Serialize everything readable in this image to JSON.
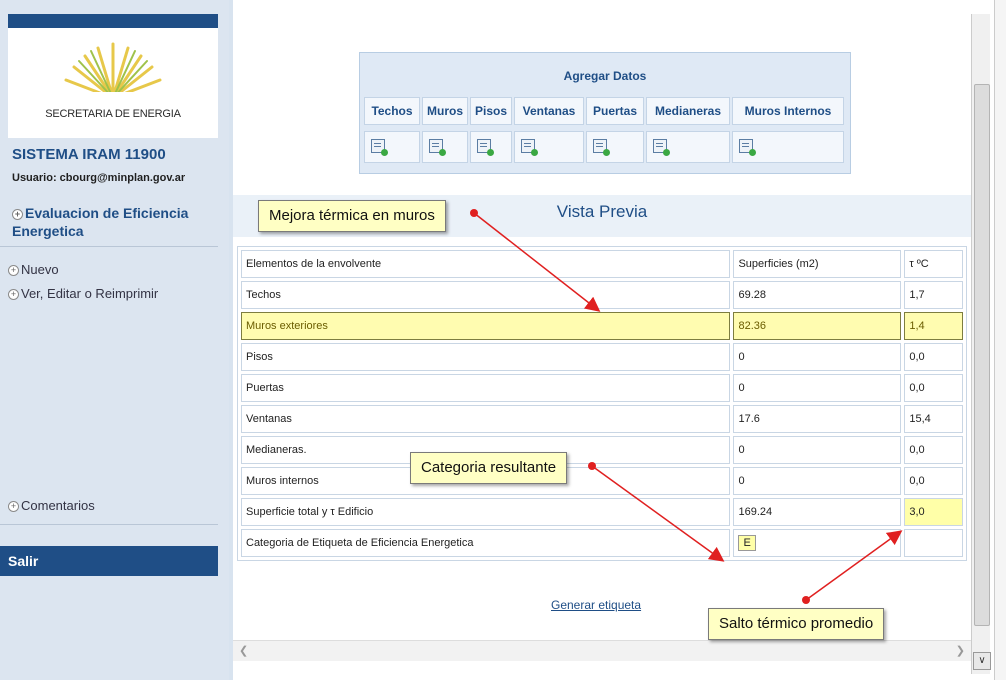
{
  "sidebar": {
    "logo_text": "SECRETARIA DE ENERGIA",
    "system_title": "SISTEMA IRAM 11900",
    "user_line": "Usuario: cbourg@minplan.gov.ar",
    "section_title": "Evaluacion de Eficiencia Energetica",
    "links": [
      "Nuevo",
      "Ver, Editar o Reimprimir"
    ],
    "comments_label": "Comentarios",
    "logout_label": "Salir"
  },
  "add_data": {
    "title": "Agregar Datos",
    "columns": [
      "Techos",
      "Muros",
      "Pisos",
      "Ventanas",
      "Puertas",
      "Medianeras",
      "Muros Internos"
    ]
  },
  "preview": {
    "title": "Vista Previa",
    "headers": [
      "Elementos de la envolvente",
      "Superficies (m2)",
      "τ ºC"
    ],
    "rows": [
      {
        "element": "Techos",
        "surface": "69.28",
        "tau": "1,7"
      },
      {
        "element": "Muros exteriores",
        "surface": "82.36",
        "tau": "1,4"
      },
      {
        "element": "Pisos",
        "surface": "0",
        "tau": "0,0"
      },
      {
        "element": "Puertas",
        "surface": "0",
        "tau": "0,0"
      },
      {
        "element": "Ventanas",
        "surface": "17.6",
        "tau": "15,4"
      },
      {
        "element": "Medianeras.",
        "surface": "0",
        "tau": "0,0"
      },
      {
        "element": "Muros internos",
        "surface": "0",
        "tau": "0,0"
      },
      {
        "element": "Superficie total y τ Edificio",
        "surface": "169.24",
        "tau": "3,0"
      }
    ],
    "category_label": "Categoria de Etiqueta de Eficiencia Energetica",
    "category_value": "E",
    "generate_link": "Generar etiqueta"
  },
  "annotations": {
    "walls": "Mejora térmica en muros",
    "category": "Categoria resultante",
    "thermal": "Salto térmico promedio",
    "arrow_color": "#e02020"
  }
}
